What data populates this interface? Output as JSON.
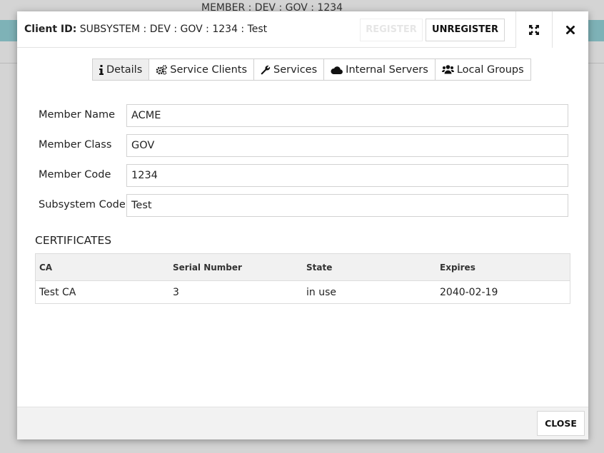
{
  "background": {
    "header_text": "MEMBER : DEV : GOV : 1234",
    "bar_color": "#7eb2b7"
  },
  "modal": {
    "title_label": "Client ID:",
    "title_value": "SUBSYSTEM : DEV : GOV : 1234 : Test",
    "register_label": "REGISTER",
    "unregister_label": "UNREGISTER",
    "expand_icon": "expand-icon",
    "close_icon": "close-icon"
  },
  "tabs": [
    {
      "label": "Details",
      "icon": "info-icon",
      "active": true
    },
    {
      "label": "Service Clients",
      "icon": "gears-icon",
      "active": false
    },
    {
      "label": "Services",
      "icon": "wrench-icon",
      "active": false
    },
    {
      "label": "Internal Servers",
      "icon": "cloud-icon",
      "active": false
    },
    {
      "label": "Local Groups",
      "icon": "users-icon",
      "active": false
    }
  ],
  "details": {
    "fields": [
      {
        "label": "Member Name",
        "value": "ACME"
      },
      {
        "label": "Member Class",
        "value": "GOV"
      },
      {
        "label": "Member Code",
        "value": "1234"
      },
      {
        "label": "Subsystem Code",
        "value": "Test"
      }
    ]
  },
  "certificates": {
    "title": "CERTIFICATES",
    "columns": [
      "CA",
      "Serial Number",
      "State",
      "Expires"
    ],
    "rows": [
      [
        "Test CA",
        "3",
        "in use",
        "2040-02-19"
      ]
    ]
  },
  "footer": {
    "close_label": "CLOSE"
  }
}
